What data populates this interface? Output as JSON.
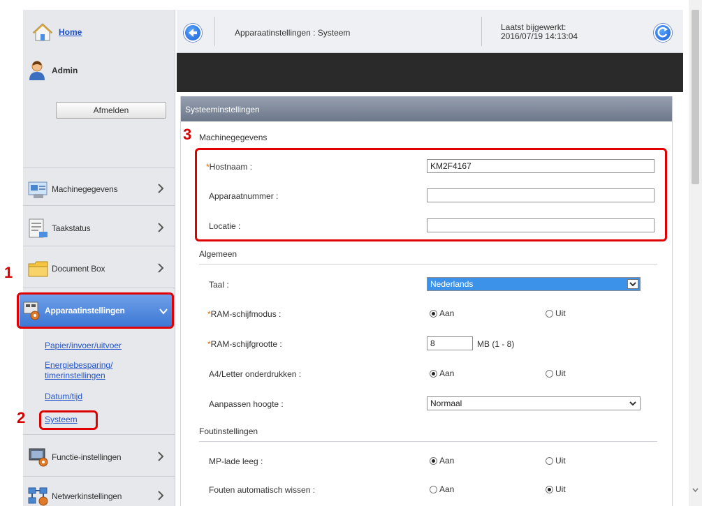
{
  "sidebar": {
    "home_label": "Home",
    "user_label": "Admin",
    "logout_label": "Afmelden",
    "items": [
      {
        "label": "Machinegegevens"
      },
      {
        "label": "Taakstatus"
      },
      {
        "label": "Document Box"
      },
      {
        "label": "Apparaatinstellingen"
      },
      {
        "label": "Functie-instellingen"
      },
      {
        "label": "Netwerkinstellingen"
      }
    ],
    "sub_items": [
      {
        "label": "Papier/invoer/uitvoer"
      },
      {
        "label": "Energiebesparing/"
      },
      {
        "label": "timerinstellingen"
      },
      {
        "label": "Datum/tijd"
      },
      {
        "label": "Systeem"
      }
    ]
  },
  "topbar": {
    "title": "Apparaatinstellingen : Systeem",
    "updated_label": "Laatst bijgewerkt:",
    "updated_value": "2016/07/19 14:13:04"
  },
  "content": {
    "header": "Systeeminstellingen",
    "machine_section": "Machinegegevens",
    "hostname_label": "Hostnaam :",
    "hostname_value": "KM2F4167",
    "device_number_label": "Apparaatnummer :",
    "device_number_value": "",
    "location_label": "Locatie :",
    "location_value": "",
    "general_section": "Algemeen",
    "language_label": "Taal :",
    "language_value": "Nederlands",
    "ramdisk_mode_label": "RAM-schijfmodus :",
    "ramdisk_size_label": "RAM-schijfgrootte :",
    "ramdisk_size_value": "8",
    "ramdisk_size_unit": "MB (1 - 8)",
    "a4_label": "A4/Letter onderdrukken :",
    "height_label": "Aanpassen hoogte :",
    "height_value": "Normaal",
    "error_section": "Foutinstellingen",
    "mp_label": "MP-lade leeg :",
    "auto_clear_label": "Fouten automatisch wissen :",
    "on_label": "Aan",
    "off_label": "Uit",
    "required_mark": "*"
  },
  "callouts": {
    "one": "1",
    "two": "2",
    "three": "3"
  },
  "colors": {
    "accent": "#3d78d5",
    "callout": "#e00000",
    "link": "#2454c8"
  }
}
